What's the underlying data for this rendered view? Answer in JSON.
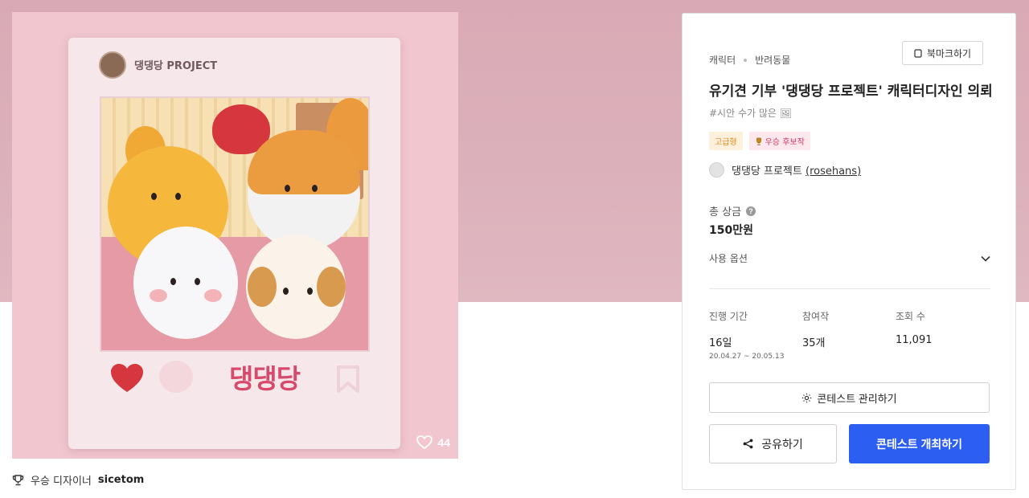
{
  "artwork": {
    "frame_title": "댕댕당 PROJECT",
    "frame_logo_text": "댕댕당",
    "like_count": "44",
    "colors": {
      "background": "#f1c6cf",
      "logo": "#d84a6c",
      "heart": "#d6363e"
    }
  },
  "winner_line": {
    "prefix": "우승 디자이너",
    "name": "sicetom"
  },
  "panel": {
    "breadcrumb": [
      "캐릭터",
      "반려동물"
    ],
    "bookmark_label": "북마크하기",
    "title": "유기견 기부 '댕댕당 프로젝트' 캐릭터디자인 의뢰",
    "subtag": "#시안 수가 많은 🖼",
    "badges": {
      "grade": "고급형",
      "winner": "우승 후보작"
    },
    "author": {
      "name": "댕댕당 프로젝트",
      "id": "(rosehans)"
    },
    "prize": {
      "label": "총 상금",
      "value": "150만원"
    },
    "usage_label": "사용 옵션",
    "stats": [
      {
        "label": "진행 기간",
        "value": "16일",
        "range": "20.04.27  ~  20.05.13"
      },
      {
        "label": "참여작",
        "value": "35개"
      },
      {
        "label": "조회 수",
        "value": "11,091"
      }
    ],
    "manage_label": "콘테스트 관리하기",
    "share_label": "공유하기",
    "host_label": "콘테스트 개최하기",
    "accent_color": "#2d5ef2"
  }
}
